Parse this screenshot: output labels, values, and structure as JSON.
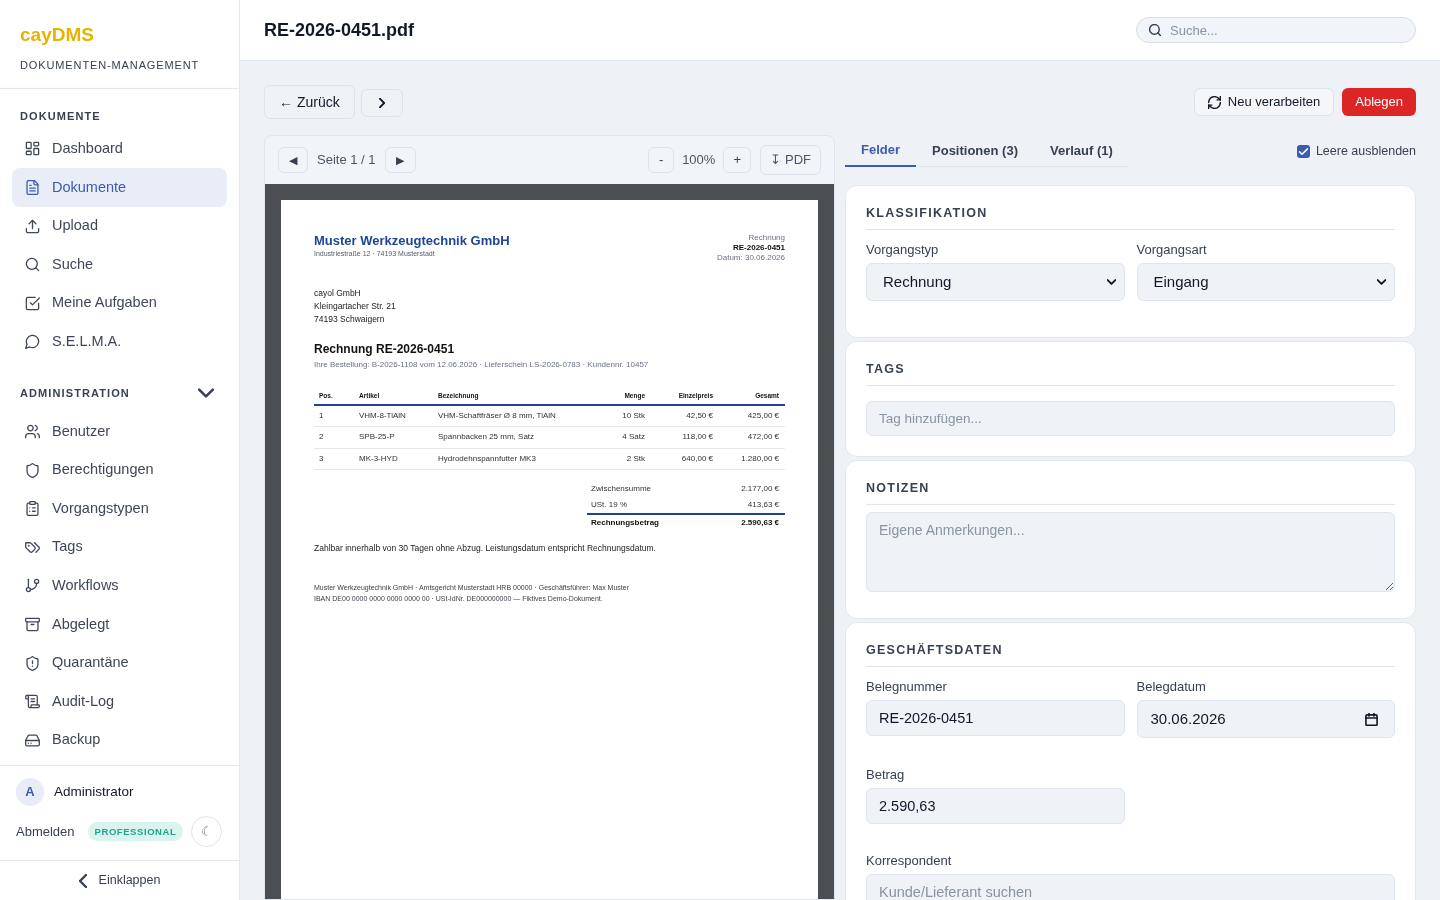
{
  "sidebar": {
    "logo": "cayDMS",
    "subtitle": "DOKUMENTEN-MANAGEMENT",
    "main_section": {
      "title": "DOKUMENTE",
      "items": [
        {
          "label": "Dashboard",
          "selected": false
        },
        {
          "label": "Dokumente",
          "selected": true
        },
        {
          "label": "Upload",
          "selected": false
        },
        {
          "label": "Suche",
          "selected": false
        },
        {
          "label": "Meine Aufgaben",
          "selected": false
        },
        {
          "label": "S.E.L.M.A.",
          "selected": false
        }
      ]
    },
    "admin_section": {
      "title": "ADMINISTRATION",
      "expanded": true,
      "items": [
        {
          "label": "Benutzer",
          "selected": false
        },
        {
          "label": "Berechtigungen",
          "selected": false
        },
        {
          "label": "Vorgangstypen",
          "selected": false
        },
        {
          "label": "Tags",
          "selected": false
        },
        {
          "label": "Workflows",
          "selected": false
        },
        {
          "label": "Abgelegt",
          "selected": false
        },
        {
          "label": "Quarantäne",
          "selected": false
        },
        {
          "label": "Audit-Log",
          "selected": false
        },
        {
          "label": "Backup",
          "selected": false
        }
      ]
    },
    "user": {
      "initial": "A",
      "name": "Administrator"
    },
    "logout": "Abmelden",
    "plan_badge": "PROFESSIONAL",
    "theme_toggle": "☾",
    "collapse": "Einklappen"
  },
  "header": {
    "title": "RE-2026-0451.pdf",
    "search": {
      "placeholder": "Suche..."
    }
  },
  "toolbar": {
    "back": "← Zurück",
    "actions": [
      {
        "label": "Neu verarbeiten",
        "kind": "secondary"
      },
      {
        "label": "Ablegen",
        "kind": "primary"
      }
    ]
  },
  "viewer": {
    "prev": "◀",
    "page": "Seite 1 / 1",
    "next": "▶",
    "zoom_out": "-",
    "zoom": "100%",
    "zoom_in": "+",
    "download": "↧ PDF",
    "document": {
      "company": "Muster Werkzeugtechnik GmbH",
      "company_address": "Industriestraße 12 · 74193 Musterstadt",
      "doc_type": "Rechnung",
      "doc_number": "RE-2026-0451",
      "date": "Datum: 30.06.2026",
      "recipient": [
        "cayol GmbH",
        "Kleingartacher Str. 21",
        "74193 Schwaigern"
      ],
      "heading": "Rechnung RE-2026-0451",
      "reference": "Ihre Bestellung: B-2026-1108 vom 12.06.2026 · Lieferschein LS-2026-0783 · Kundennr. 10457",
      "table": {
        "columns": [
          "Pos.",
          "Artikel",
          "Bezeichnung",
          "Menge",
          "Einzelpreis",
          "Gesamt"
        ],
        "rows": [
          [
            "1",
            "VHM-8-TiAlN",
            "VHM-Schaftfräser Ø 8 mm, TiAlN",
            "10 Stk",
            "42,50 €",
            "425,00 €"
          ],
          [
            "2",
            "SPB-25-P",
            "Spannbacken 25 mm, Satz",
            "4 Satz",
            "118,00 €",
            "472,00 €"
          ],
          [
            "3",
            "MK-3-HYD",
            "Hydrodehnspannfutter MK3",
            "2 Stk",
            "640,00 €",
            "1.280,00 €"
          ]
        ]
      },
      "totals": [
        {
          "label": "Zwischensumme",
          "value": "2.177,00 €",
          "kind": "subtotal"
        },
        {
          "label": "USt. 19 %",
          "value": "413,63 €",
          "kind": "subtotal"
        },
        {
          "label": "Rechnungsbetrag",
          "value": "2.590,63 €",
          "kind": "total"
        }
      ],
      "payment_note": "Zahlbar innerhalb von 30 Tagen ohne Abzug. Leistungsdatum entspricht Rechnungsdatum.",
      "footer": [
        "Muster Werkzeugtechnik GmbH · Amtsgericht Musterstadt HRB 00000 · Geschäftsführer: Max Muster",
        "IBAN DE00 0000 0000 0000 0000 00 · USt-IdNr. DE000000000 — Fiktives Demo-Dokument."
      ]
    }
  },
  "details": {
    "tabs": [
      {
        "label": "Felder",
        "selected": true
      },
      {
        "label": "Positionen (3)",
        "selected": false
      },
      {
        "label": "Verlauf (1)",
        "selected": false
      }
    ],
    "hide_empty": {
      "label": "Leere ausblenden",
      "checked": true
    },
    "panels": [
      {
        "title": "KLASSIFIKATION",
        "fields": [
          {
            "kind": "select",
            "label": "Vorgangstyp",
            "value": "Rechnung"
          },
          {
            "kind": "select",
            "label": "Vorgangsart",
            "value": "Eingang"
          }
        ]
      },
      {
        "title": "TAGS",
        "fields": [
          {
            "kind": "tag_input",
            "placeholder": "Tag hinzufügen..."
          }
        ]
      },
      {
        "title": "NOTIZEN",
        "fields": [
          {
            "kind": "textarea",
            "placeholder": "Eigene Anmerkungen..."
          }
        ]
      },
      {
        "title": "GESCHÄFTSDATEN",
        "fields": [
          {
            "kind": "text",
            "label": "Belegnummer",
            "value": "RE-2026-0451"
          },
          {
            "kind": "date",
            "label": "Belegdatum",
            "value": "30.06.2026"
          },
          {
            "kind": "text",
            "label": "Betrag",
            "value": "2.590,63"
          },
          {
            "kind": "search",
            "label": "Korrespondent",
            "placeholder": "Kunde/Lieferant suchen"
          }
        ]
      }
    ]
  }
}
